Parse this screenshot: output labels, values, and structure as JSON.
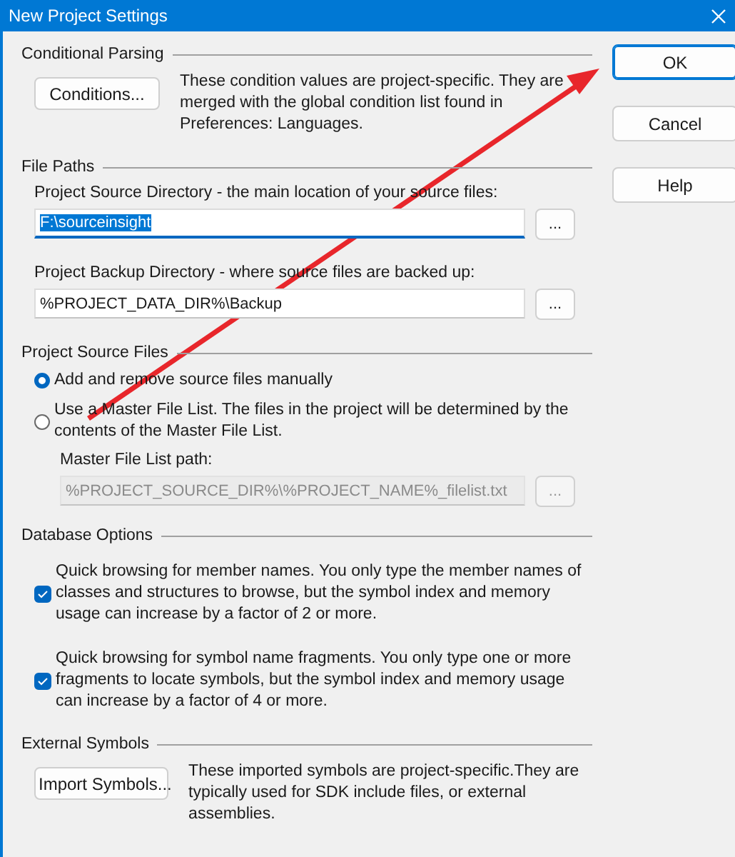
{
  "window": {
    "title": "New Project Settings"
  },
  "conditional_parsing": {
    "heading": "Conditional Parsing",
    "button": "Conditions...",
    "description": "These condition values are project-specific.  They are merged with the global condition list found in Preferences: Languages."
  },
  "file_paths": {
    "heading": "File Paths",
    "fields": [
      {
        "label": "Project Source Directory - the main location of your source files:",
        "value": "F:\\sourceinsight",
        "focused": true,
        "browse": "..."
      },
      {
        "label": "Project Backup Directory - where source files are backed up:",
        "value": "%PROJECT_DATA_DIR%\\Backup",
        "focused": false,
        "browse": "..."
      }
    ]
  },
  "project_source_files": {
    "heading": "Project Source Files",
    "options": [
      {
        "label": "Add and remove source files manually",
        "selected": true
      },
      {
        "label": "Use a Master File List. The files in the project will be determined by the contents of the Master File List.",
        "selected": false
      }
    ],
    "master_list": {
      "label": "Master File List path:",
      "value": "%PROJECT_SOURCE_DIR%\\%PROJECT_NAME%_filelist.txt",
      "disabled": true,
      "browse": "..."
    }
  },
  "database_options": {
    "heading": "Database Options",
    "options": [
      {
        "label": "Quick browsing for member names.  You only type the member names of classes and structures to browse, but the symbol index and memory usage can increase by a factor of 2 or more.",
        "checked": true
      },
      {
        "label": "Quick browsing for symbol name fragments.  You only type one or more fragments to locate symbols, but the symbol index and memory usage can increase by a factor of 4 or more.",
        "checked": true
      }
    ]
  },
  "external_symbols": {
    "heading": "External Symbols",
    "button": "Import Symbols...",
    "description": "These imported symbols are project-specific.They are typically used for SDK include files, or external assemblies."
  },
  "buttons": [
    {
      "label": "OK",
      "default": true
    },
    {
      "label": "Cancel",
      "default": false
    },
    {
      "label": "Help",
      "default": false
    }
  ]
}
